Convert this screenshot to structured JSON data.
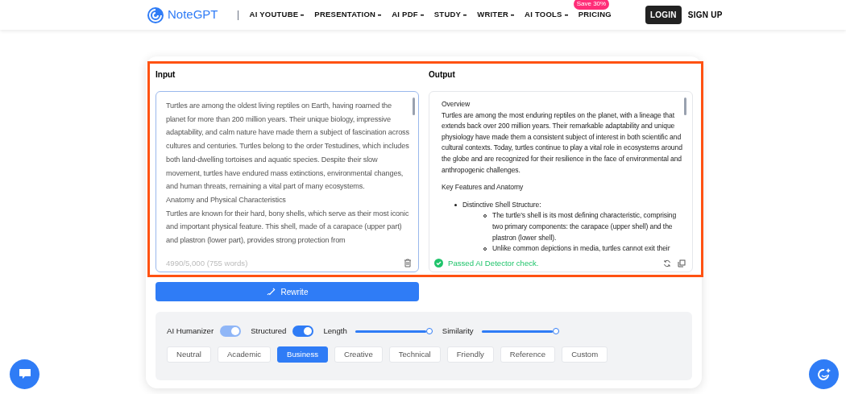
{
  "header": {
    "logo": "NoteGPT",
    "nav": [
      {
        "label": "AI YOUTUBE",
        "dropdown": true
      },
      {
        "label": "PRESENTATION",
        "dropdown": true
      },
      {
        "label": "AI PDF",
        "dropdown": true
      },
      {
        "label": "STUDY",
        "dropdown": true
      },
      {
        "label": "WRITER",
        "dropdown": true
      },
      {
        "label": "AI TOOLS",
        "dropdown": true
      },
      {
        "label": "PRICING",
        "dropdown": false,
        "badge": "Save 30%"
      }
    ],
    "login": "LOGIN",
    "signup": "SIGN UP"
  },
  "input": {
    "heading": "Input",
    "paragraphs": [
      "Turtles are among the oldest living reptiles on Earth, having roamed the planet for more than 200 million years. Their unique biology, impressive adaptability, and calm nature have made them a subject of fascination across cultures and centuries. Turtles belong to the order Testudines, which includes both land-dwelling tortoises and aquatic species. Despite their slow movement, turtles have endured mass extinctions, environmental changes, and human threats, remaining a vital part of many ecosystems.",
      "Anatomy and Physical Characteristics",
      "Turtles are known for their hard, bony shells, which serve as their most iconic and important physical feature. This shell, made of a carapace (upper part) and plastron (lower part), provides strong protection from"
    ],
    "counter": "4990/5,000 (755 words)"
  },
  "output": {
    "heading": "Output",
    "blocks": [
      {
        "kind": "line",
        "text": "Overview"
      },
      {
        "kind": "para",
        "text": "Turtles are among the most enduring reptiles on the planet, with a lineage that extends back over 200 million years. Their remarkable adaptability and unique physiology have made them a consistent subject of interest in both scientific and cultural contexts. Today, turtles continue to play a vital role in ecosystems around the globe and are recognized for their resilience in the face of environmental and anthropogenic challenges."
      },
      {
        "kind": "para",
        "text": "Key Features and Anatomy"
      },
      {
        "kind": "bullet",
        "text": "Distinctive Shell Structure:"
      },
      {
        "kind": "subbullet",
        "text": "The turtle's shell is its most defining characteristic, comprising two primary components: the carapace (upper shell) and the plastron (lower shell)."
      },
      {
        "kind": "subbullet",
        "text": "Unlike common depictions in media, turtles cannot exit their"
      }
    ],
    "status": "Passed AI Detector check."
  },
  "rewrite_button": "Rewrite",
  "settings": {
    "toggles": [
      {
        "label": "AI Humanizer",
        "on": true,
        "disabled": true
      },
      {
        "label": "Structured",
        "on": true,
        "disabled": false
      }
    ],
    "sliders": [
      {
        "label": "Length",
        "level": 1
      },
      {
        "label": "Similarity",
        "level": 1
      }
    ],
    "tones": [
      {
        "label": "Neutral",
        "selected": false
      },
      {
        "label": "Academic",
        "selected": false
      },
      {
        "label": "Business",
        "selected": true
      },
      {
        "label": "Creative",
        "selected": false
      },
      {
        "label": "Technical",
        "selected": false
      },
      {
        "label": "Friendly",
        "selected": false
      },
      {
        "label": "Reference",
        "selected": false
      },
      {
        "label": "Custom",
        "selected": false
      }
    ]
  }
}
